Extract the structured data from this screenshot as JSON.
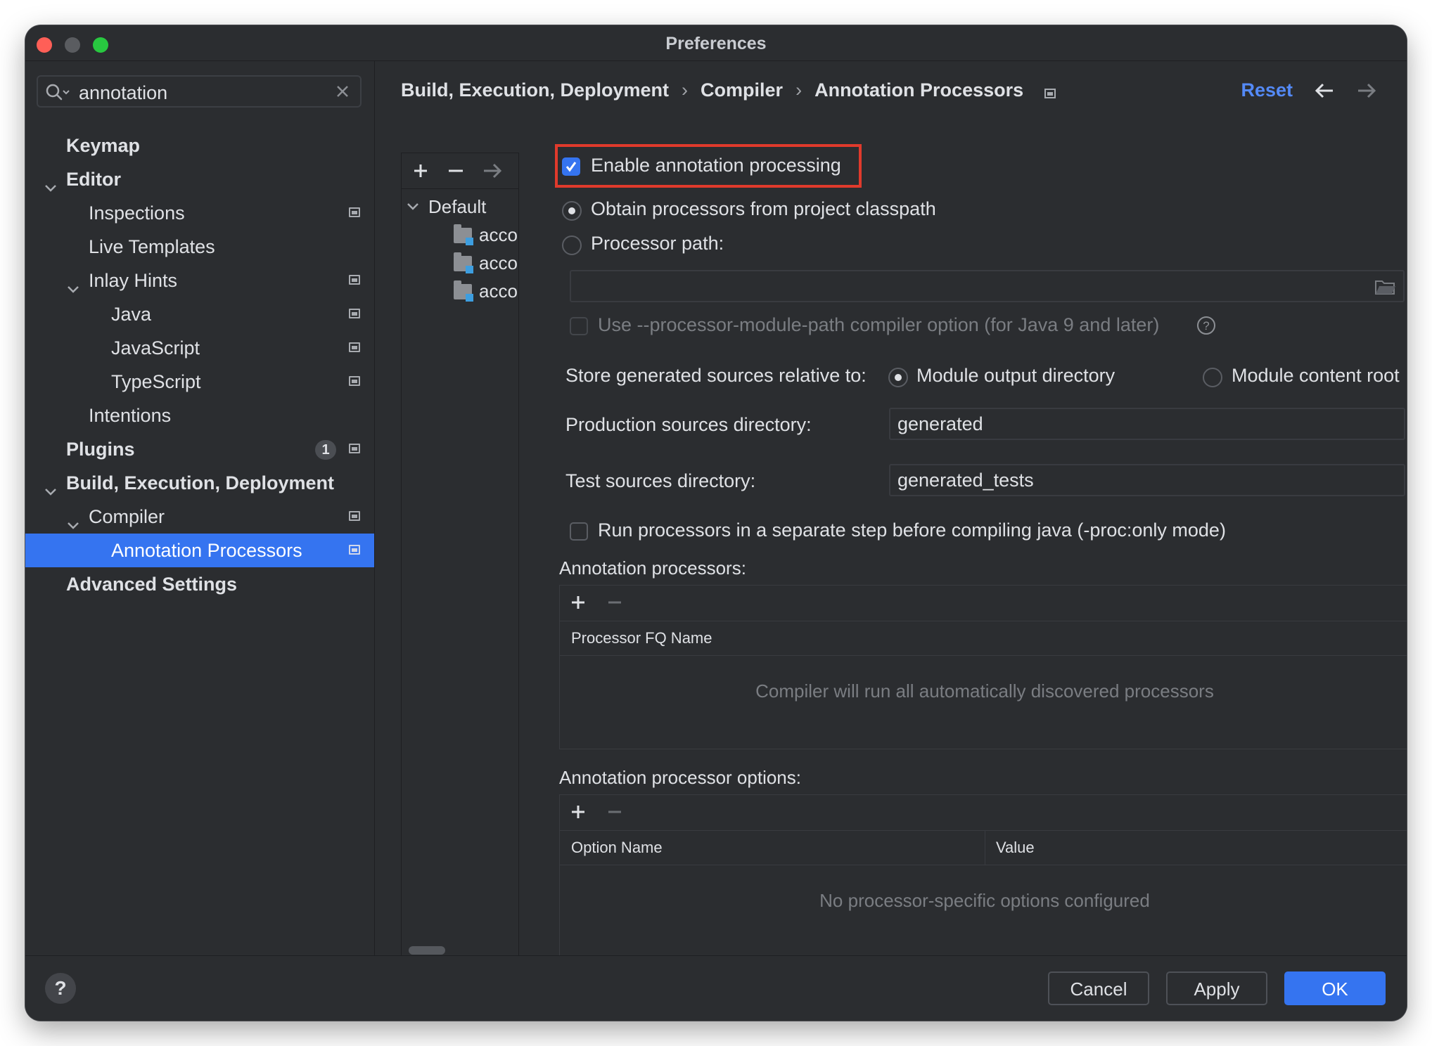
{
  "window": {
    "title": "Preferences"
  },
  "search": {
    "value": "annotation"
  },
  "sidebar": {
    "items": [
      {
        "label": "Keymap"
      },
      {
        "label": "Editor"
      },
      {
        "label": "Inspections"
      },
      {
        "label": "Live Templates"
      },
      {
        "label": "Inlay Hints"
      },
      {
        "label": "Java"
      },
      {
        "label": "JavaScript"
      },
      {
        "label": "TypeScript"
      },
      {
        "label": "Intentions"
      },
      {
        "label": "Plugins",
        "badge": "1"
      },
      {
        "label": "Build, Execution, Deployment"
      },
      {
        "label": "Compiler"
      },
      {
        "label": "Annotation Processors"
      },
      {
        "label": "Advanced Settings"
      }
    ]
  },
  "breadcrumb": {
    "items": [
      "Build, Execution, Deployment",
      "Compiler",
      "Annotation Processors"
    ],
    "separator": "›"
  },
  "header": {
    "reset_label": "Reset"
  },
  "profiles": {
    "root": "Default",
    "children": [
      "acco",
      "acco",
      "acco"
    ]
  },
  "options": {
    "enable_label": "Enable annotation processing",
    "enable_checked": true,
    "obtain_label": "Obtain processors from project classpath",
    "processor_path_label": "Processor path:",
    "processor_path_value": "",
    "module_path_label": "Use --processor-module-path compiler option (for Java 9 and later)",
    "store_label": "Store generated sources relative to:",
    "module_output_label": "Module output directory",
    "module_content_label": "Module content root",
    "prod_dir_label": "Production sources directory:",
    "prod_dir_value": "generated",
    "test_dir_label": "Test sources directory:",
    "test_dir_value": "generated_tests",
    "proc_only_label": "Run processors in a separate step before compiling java (-proc:only mode)"
  },
  "processors_table": {
    "title": "Annotation processors:",
    "column": "Processor FQ Name",
    "empty_text": "Compiler will run all automatically discovered processors"
  },
  "options_table": {
    "title": "Annotation processor options:",
    "columns": [
      "Option Name",
      "Value"
    ],
    "empty_text": "No processor-specific options configured"
  },
  "footer": {
    "help": "?",
    "cancel": "Cancel",
    "apply": "Apply",
    "ok": "OK"
  },
  "colors": {
    "accent": "#3574f0",
    "highlight_box": "#e03a2c",
    "background": "#2b2d30"
  }
}
